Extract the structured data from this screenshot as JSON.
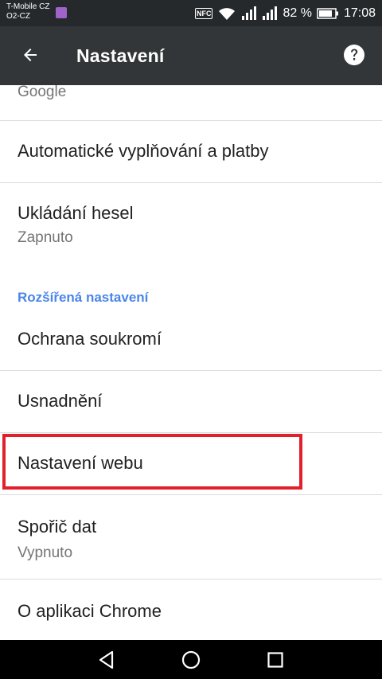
{
  "status_bar": {
    "carrier1": "T-Mobile CZ",
    "carrier2": "O2-CZ",
    "nfc": "NFC",
    "battery": "82 %",
    "time": "17:08"
  },
  "toolbar": {
    "title": "Nastavení",
    "back_icon": "arrow-back-icon",
    "help_icon": "help-icon"
  },
  "list": {
    "partial_item": "Google",
    "autofill": "Automatické vyplňování a platby",
    "passwords": {
      "title": "Ukládání hesel",
      "subtitle": "Zapnuto"
    },
    "advanced_header": "Rozšířená nastavení",
    "privacy": "Ochrana soukromí",
    "accessibility": "Usnadnění",
    "site_settings": "Nastavení webu",
    "data_saver": {
      "title": "Spořič dat",
      "subtitle": "Vypnuto"
    },
    "about": "O aplikaci Chrome"
  },
  "colors": {
    "status_bar": "#26292c",
    "toolbar": "#323639",
    "section_header": "#4a86e8",
    "highlight": "#e0202a"
  }
}
